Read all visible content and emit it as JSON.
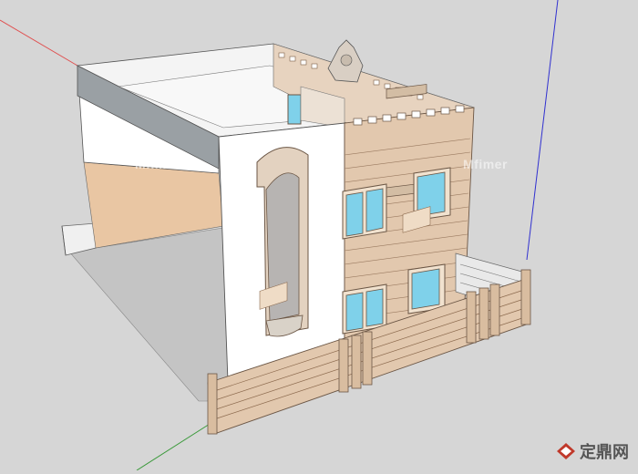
{
  "scene": {
    "background": "#d6d6d6",
    "axes": {
      "red": "#e05050",
      "green": "#3a9a3a",
      "blue": "#3030d0"
    },
    "colors": {
      "white_wall": "#ffffff",
      "facade": "#e2c8ae",
      "facade_line": "#8c6a4e",
      "interior_wall": "#e9c6a3",
      "shadow": "#c4c4c4",
      "window_glass": "#7fd1ea",
      "window_frame": "#f1e2cf"
    }
  },
  "watermarks": [
    "Mfimer",
    "Mfimer"
  ],
  "brand": {
    "text": "定鼎网",
    "icon": "diamond-logo-icon"
  }
}
